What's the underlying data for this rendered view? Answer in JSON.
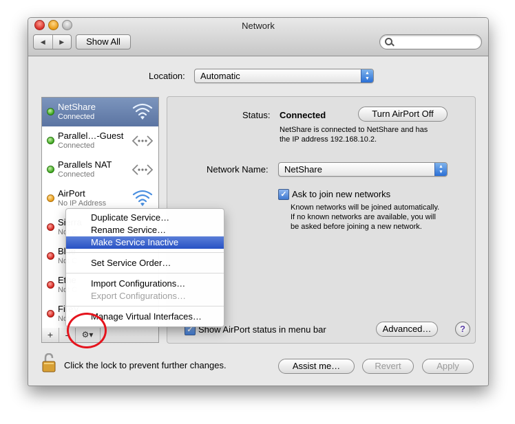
{
  "window": {
    "title": "Network",
    "show_all": "Show All"
  },
  "location": {
    "label": "Location:",
    "value": "Automatic"
  },
  "services": [
    {
      "name": "NetShare",
      "status": "Connected",
      "dot": "green",
      "icon": "wifi-icon",
      "selected": true
    },
    {
      "name": "Parallel…-Guest",
      "status": "Connected",
      "dot": "green",
      "icon": "ethernet-arrows-icon"
    },
    {
      "name": "Parallels NAT",
      "status": "Connected",
      "dot": "green",
      "icon": "ethernet-arrows-icon"
    },
    {
      "name": "AirPort",
      "status": "No IP Address",
      "dot": "yellow",
      "icon": "wifi-icon"
    },
    {
      "name": "Sierra",
      "status": "Not C",
      "dot": "red"
    },
    {
      "name": "Blue",
      "status": "Not C",
      "dot": "red"
    },
    {
      "name": "Ethe",
      "status": "Not C",
      "dot": "red"
    },
    {
      "name": "FireV",
      "status": "Not",
      "dot": "red"
    }
  ],
  "list_controls": {
    "add": "+",
    "remove": "-",
    "gear": "⚙▾"
  },
  "detail": {
    "status_label": "Status:",
    "status_value": "Connected",
    "turn_off": "Turn AirPort Off",
    "status_desc_1": "NetShare is connected to NetShare and has",
    "status_desc_2": "the IP address 192.168.10.2.",
    "network_name_label": "Network Name:",
    "network_name_value": "NetShare",
    "ask_join": "Ask to join new networks",
    "ask_desc_1": "Known networks will be joined automatically.",
    "ask_desc_2": "If no known networks are available, you will",
    "ask_desc_3": "be asked before joining a new network.",
    "show_status": "Show AirPort status in menu bar",
    "advanced": "Advanced…",
    "help": "?"
  },
  "menu": {
    "items": [
      "Duplicate Service…",
      "Rename Service…",
      "Make Service Inactive",
      "Set Service Order…",
      "Import Configurations…",
      "Export Configurations…",
      "Manage Virtual Interfaces…"
    ]
  },
  "footer": {
    "lock_text": "Click the lock to prevent further changes.",
    "assist": "Assist me…",
    "revert": "Revert",
    "apply": "Apply"
  },
  "colors": {
    "selection": "#5b74a2",
    "menu_highlight": "#2852c4",
    "annotation_circle": "#e5141d"
  }
}
